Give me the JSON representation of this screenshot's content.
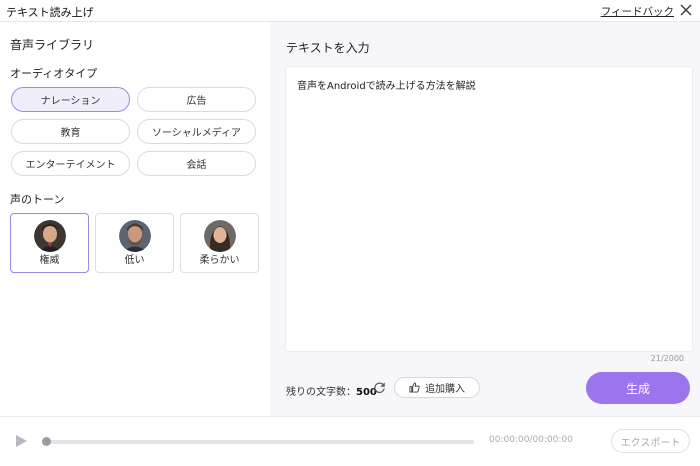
{
  "window": {
    "title": "テキスト読み上げ",
    "feedback_label": "フィードバック"
  },
  "left": {
    "library_title": "音声ライブラリ",
    "audio_type_title": "オーディオタイプ",
    "audio_types": [
      "ナレーション",
      "広告",
      "教育",
      "ソーシャルメディア",
      "エンターテイメント",
      "会話"
    ],
    "selected_audio_type": "ナレーション",
    "tone_title": "声のトーン",
    "tones": [
      "権威",
      "低い",
      "柔らかい"
    ],
    "selected_tone": "権威"
  },
  "right": {
    "heading": "テキストを入力",
    "input_text": "音声をAndroidで読み上げる方法を解説",
    "counter": "21/2000",
    "remaining_label": "残りの文字数：",
    "remaining_value": "500",
    "purchase_label": "追加購入",
    "generate_label": "生成"
  },
  "player": {
    "time": "00:00:00/00:00:00",
    "progress": 0,
    "export_label": "エクスポート"
  },
  "colors": {
    "accent": "#9b75ee",
    "selected_border": "#9b8ae6",
    "panel_bg": "#f6f6fb"
  }
}
